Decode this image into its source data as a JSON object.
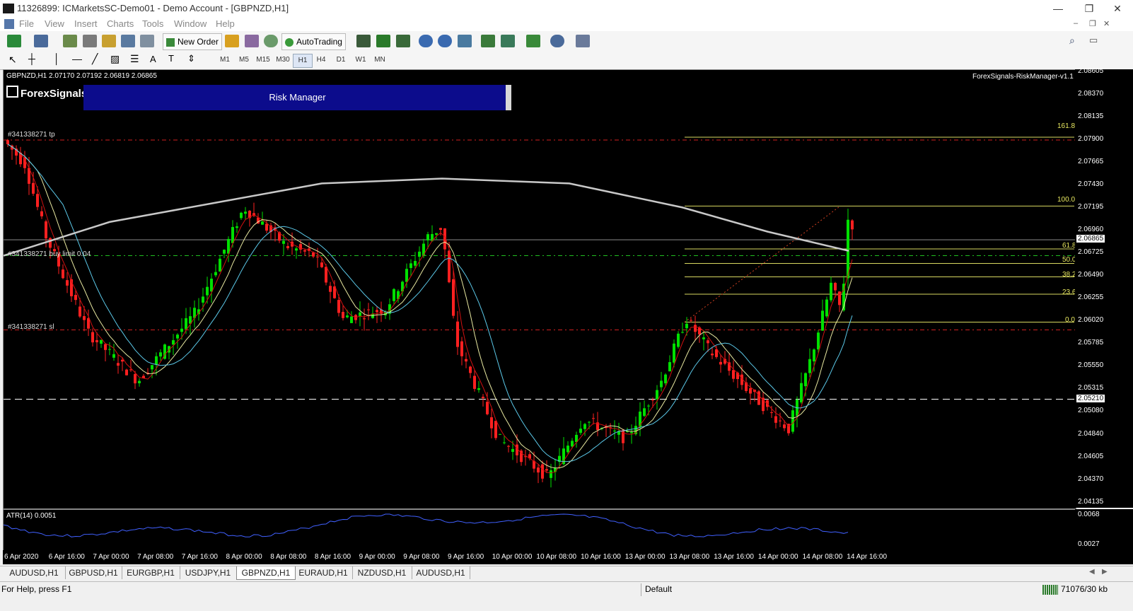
{
  "window": {
    "title": "11326899: ICMarketsSC-Demo01 - Demo Account - [GBPNZD,H1]",
    "minimize": "—",
    "restore": "❐",
    "close": "✕"
  },
  "menu": [
    "File",
    "View",
    "Insert",
    "Charts",
    "Tools",
    "Window",
    "Help"
  ],
  "toolbar": {
    "new_order": "New Order",
    "autotrading": "AutoTrading",
    "timeframes": [
      "M1",
      "M5",
      "M15",
      "M30",
      "H1",
      "H4",
      "D1",
      "W1",
      "MN"
    ],
    "active_timeframe": "H1"
  },
  "chart": {
    "header": "GBPNZD,H1  2.07170 2.07192 2.06819 2.06865",
    "logo": "ForexSignals",
    "indicator_title": "ForexSignals-RiskManager-v1.1",
    "risk_manager_label": "Risk Manager",
    "order_labels": {
      "tp": "#341338271 tp",
      "buy_limit": "#341338271 buy limit 0.04",
      "sl": "#341338271 sl"
    },
    "fib_levels": [
      "161.8",
      "100.0",
      "61.8",
      "50.0",
      "38.2",
      "23.6",
      "0.0"
    ],
    "price_ticks": [
      "2.08605",
      "2.08370",
      "2.08135",
      "2.07900",
      "2.07665",
      "2.07430",
      "2.07195",
      "2.06960",
      "2.06725",
      "2.06490",
      "2.06255",
      "2.06020",
      "2.05785",
      "2.05550",
      "2.05315",
      "2.05080",
      "2.04840",
      "2.04605",
      "2.04370",
      "2.04135"
    ],
    "current_price": "2.06865",
    "hline_price": "2.05210",
    "atr_label": "ATR(14) 0.0051",
    "atr_ticks": [
      "0.0068",
      "0.0027"
    ],
    "time_labels": [
      "6 Apr 2020",
      "6 Apr 16:00",
      "7 Apr 00:00",
      "7 Apr 08:00",
      "7 Apr 16:00",
      "8 Apr 00:00",
      "8 Apr 08:00",
      "8 Apr 16:00",
      "9 Apr 00:00",
      "9 Apr 08:00",
      "9 Apr 16:00",
      "10 Apr 00:00",
      "10 Apr 08:00",
      "10 Apr 16:00",
      "13 Apr 00:00",
      "13 Apr 08:00",
      "13 Apr 16:00",
      "14 Apr 00:00",
      "14 Apr 08:00",
      "14 Apr 16:00"
    ],
    "colors": {
      "bull": "#00e000",
      "bear": "#ff2020",
      "ma_fast": "#d01010",
      "ma_mid": "#e8e8a0",
      "ma_slow": "#5bc8e8",
      "ma_long": "#c8c8c8",
      "fib": "#d8d860",
      "atr": "#4060ff"
    }
  },
  "tabs": [
    "AUDUSD,H1",
    "GBPUSD,H1",
    "EURGBP,H1",
    "USDJPY,H1",
    "GBPNZD,H1",
    "EURAUD,H1",
    "NZDUSD,H1",
    "AUDUSD,H1"
  ],
  "active_tab": "GBPNZD,H1",
  "status": {
    "help": "For Help, press F1",
    "profile": "Default",
    "traffic": "71076/30 kb"
  }
}
